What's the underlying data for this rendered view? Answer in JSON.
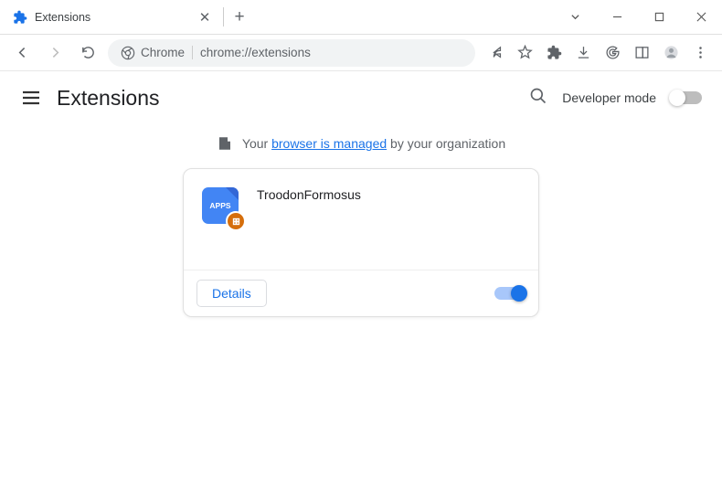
{
  "window": {
    "tab_title": "Extensions"
  },
  "omnibox": {
    "prefix_label": "Chrome",
    "url": "chrome://extensions"
  },
  "page": {
    "title": "Extensions",
    "dev_mode_label": "Developer mode"
  },
  "banner": {
    "text_before": "Your ",
    "link_text": "browser is managed",
    "text_after": " by your organization"
  },
  "extension": {
    "name": "TroodonFormosus",
    "icon_label": "APPS",
    "details_button": "Details"
  }
}
